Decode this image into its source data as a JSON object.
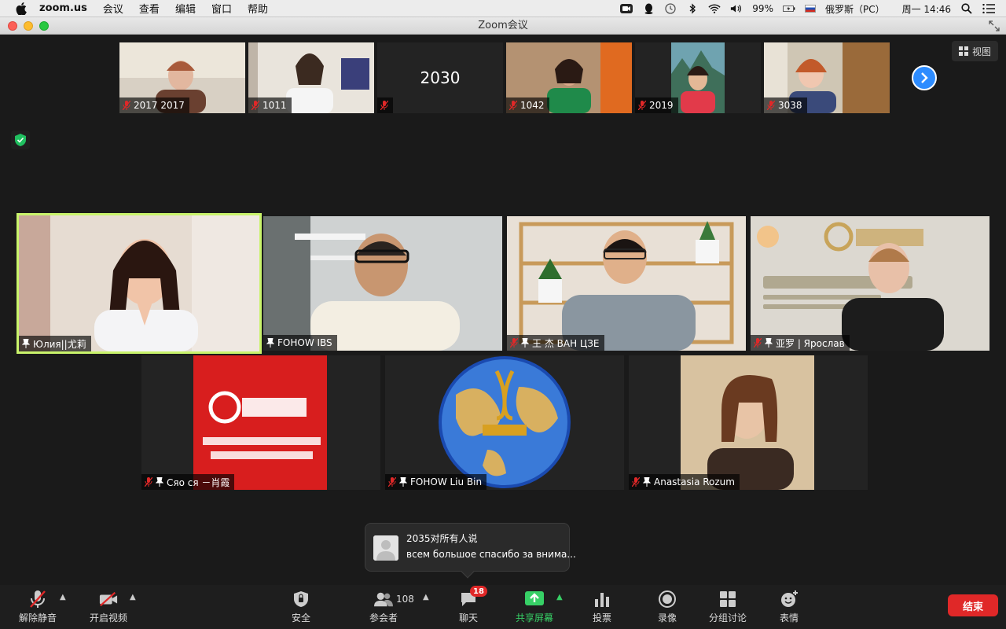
{
  "menubar": {
    "app_name": "zoom.us",
    "items": [
      "会议",
      "查看",
      "编辑",
      "窗口",
      "帮助"
    ],
    "battery": "99%",
    "input_source": "俄罗斯（PC）",
    "clock": "周一 14:46"
  },
  "window": {
    "title": "Zoom会议"
  },
  "view_button": {
    "label": "视图"
  },
  "top_strip": [
    {
      "name": "2017 2017",
      "muted": true,
      "video": true
    },
    {
      "name": "1011",
      "muted": true,
      "video": true
    },
    {
      "name": "",
      "number": "2030",
      "muted": true,
      "video": false
    },
    {
      "name": "1042",
      "muted": true,
      "video": true
    },
    {
      "name": "2019",
      "muted": true,
      "video": true
    },
    {
      "name": "3038",
      "muted": true,
      "video": true
    }
  ],
  "gallery_row1": [
    {
      "name": "Юлия||尤莉",
      "pinned": true,
      "muted": false,
      "active": true
    },
    {
      "name": "FOHOW IBS",
      "pinned": true,
      "muted": false
    },
    {
      "name": "王 杰   ВАН ЦЗЕ",
      "pinned": true,
      "muted": true
    },
    {
      "name": "亚罗 | Ярослав",
      "pinned": true,
      "muted": true
    }
  ],
  "gallery_row2": [
    {
      "name": "Сяо ся －肖霞",
      "pinned": true,
      "muted": true
    },
    {
      "name": "FOHOW Liu Bin",
      "pinned": true,
      "muted": true
    },
    {
      "name": "Anastasia Rozum",
      "pinned": true,
      "muted": true
    }
  ],
  "chat_toast": {
    "sender": "2035对所有人说",
    "message": "всем большое спасибо за внима..."
  },
  "toolbar": {
    "unmute": "解除静音",
    "start_video": "开启视频",
    "security": "安全",
    "participants": "参会者",
    "participants_count": "108",
    "chat": "聊天",
    "chat_badge": "18",
    "share_screen": "共享屏幕",
    "polls": "投票",
    "record": "录像",
    "breakout": "分组讨论",
    "reactions": "表情",
    "end": "结束"
  },
  "colors": {
    "active_speaker_border": "#c9f36b",
    "end_button": "#e02828",
    "share_green": "#37d066",
    "next_button": "#2d8cff"
  }
}
